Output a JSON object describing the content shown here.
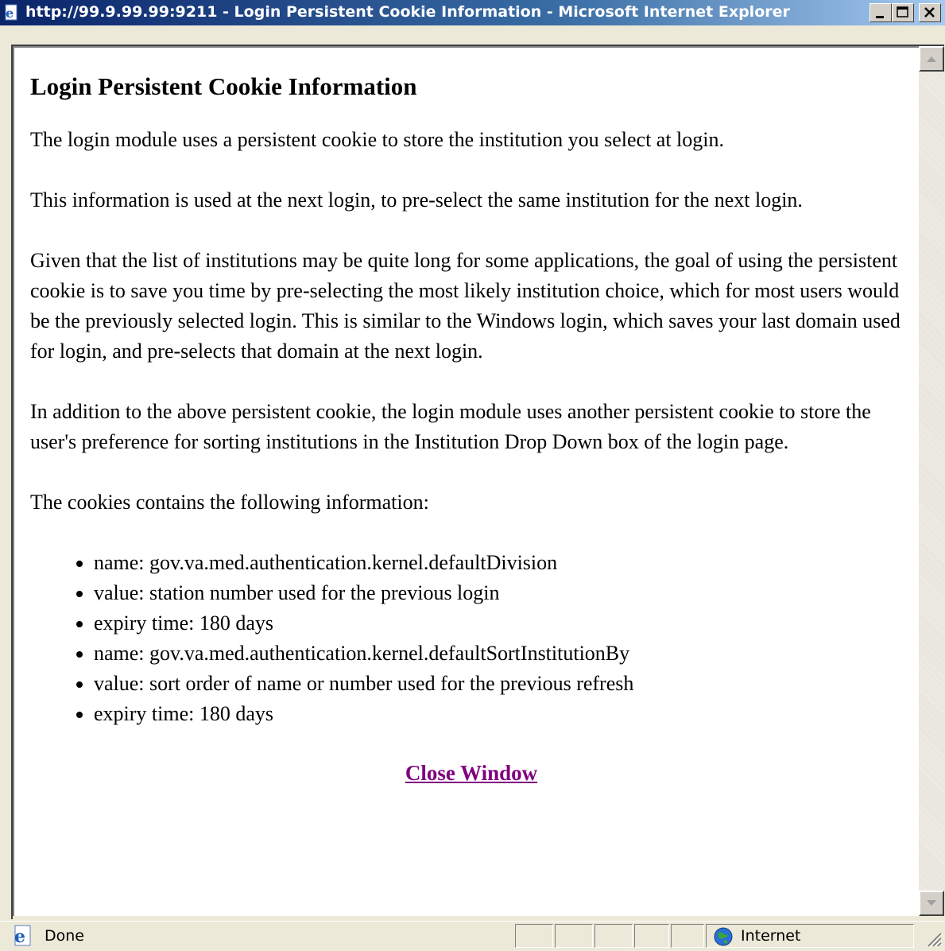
{
  "window": {
    "title": "http://99.9.99.99:9211 - Login Persistent Cookie Information - Microsoft Internet Explorer"
  },
  "page": {
    "heading": "Login Persistent Cookie Information",
    "paragraphs": [
      "The login module uses a persistent cookie to store the institution you select at login.",
      "This information is used at the next login, to pre-select the same institution for the next login.",
      "Given that the list of institutions may be quite long for some applications, the goal of using the persistent cookie is to save you time by pre-selecting the most likely institution choice, which for most users would be the previously selected login. This is similar to the Windows login, which saves your last domain used for login, and pre-selects that domain at the next login.",
      "In addition to the above persistent cookie, the login module uses another persistent cookie to store the user's preference for sorting institutions in the Institution Drop Down box of the login page.",
      "The cookies contains the following information:"
    ],
    "cookie_info": [
      "name: gov.va.med.authentication.kernel.defaultDivision",
      "value: station number used for the previous login",
      "expiry time: 180 days",
      "name: gov.va.med.authentication.kernel.defaultSortInstitutionBy",
      "value: sort order of name or number used for the previous refresh",
      "expiry time: 180 days"
    ],
    "close_link": "Close Window",
    "link_color": "#800080"
  },
  "statusbar": {
    "status": "Done",
    "zone": "Internet"
  },
  "icons": {
    "title": "ie-page-icon",
    "status": "ie-page-icon",
    "zone": "globe-icon"
  }
}
